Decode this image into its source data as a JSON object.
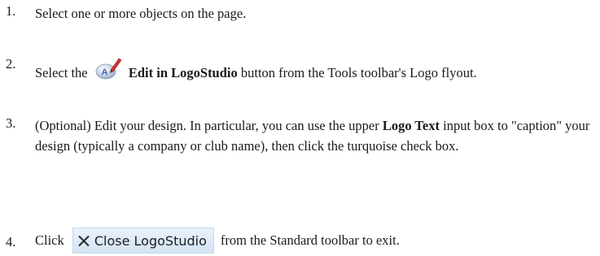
{
  "steps": [
    {
      "number": "1.",
      "text": "Select one or more objects on the page."
    },
    {
      "number": "2.",
      "pre": "Select the",
      "icon": "logostudio-edit-icon",
      "bold": "Edit in LogoStudio",
      "post": " button from the Tools toolbar's Logo flyout."
    },
    {
      "number": "3.",
      "pre": " (Optional) Edit your design. In particular, you can use the upper ",
      "bold": "Logo Text",
      "post": " input box to \"caption\" your design (typically a company or club name), then click the turquoise check box."
    },
    {
      "number": "4.",
      "pre": "Click",
      "button_icon": "close-x-icon",
      "button_label": "Close LogoStudio",
      "post": "from the Standard toolbar to exit."
    }
  ]
}
